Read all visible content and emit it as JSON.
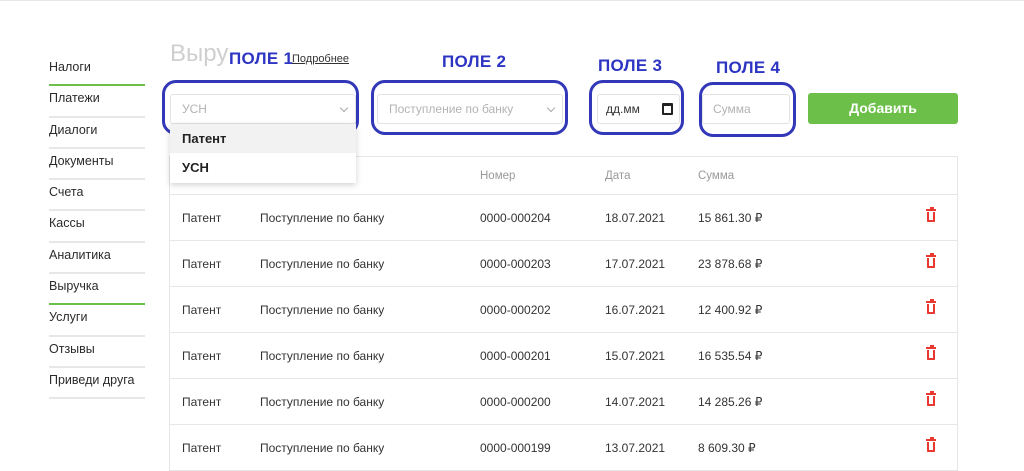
{
  "sidebar": {
    "items": [
      {
        "label": "Налоги",
        "active": true
      },
      {
        "label": "Платежи",
        "active": false
      },
      {
        "label": "Диалоги",
        "active": false
      },
      {
        "label": "Документы",
        "active": false
      },
      {
        "label": "Счета",
        "active": false
      },
      {
        "label": "Кассы",
        "active": false
      },
      {
        "label": "Аналитика",
        "active": false
      },
      {
        "label": "Выручка",
        "active": true
      },
      {
        "label": "Услуги",
        "active": false
      },
      {
        "label": "Отзывы",
        "active": false
      },
      {
        "label": "Приведи друга",
        "active": false
      }
    ]
  },
  "header": {
    "title": "Выру",
    "more_link": "Подробнее"
  },
  "annotations": {
    "field1": "ПОЛЕ 1",
    "field2": "ПОЛЕ 2",
    "field3": "ПОЛЕ 3",
    "field4": "ПОЛЕ 4",
    "outline_color": "#3238b8"
  },
  "form": {
    "tax_select_value": "УСН",
    "operation_select_placeholder": "Поступление по банку",
    "date_placeholder": "дд.мм",
    "sum_placeholder": "Сумма",
    "add_button": "Добавить",
    "accent_color": "#6cc04a"
  },
  "dropdown": {
    "options": [
      "Патент",
      "УСН"
    ]
  },
  "table": {
    "headers": {
      "number": "Номер",
      "date": "Дата",
      "sum": "Сумма"
    },
    "rows": [
      {
        "tax": "Патент",
        "operation": "Поступление по банку",
        "number": "0000-000204",
        "date": "18.07.2021",
        "sum": "15 861.30 ₽"
      },
      {
        "tax": "Патент",
        "operation": "Поступление по банку",
        "number": "0000-000203",
        "date": "17.07.2021",
        "sum": "23 878.68 ₽"
      },
      {
        "tax": "Патент",
        "operation": "Поступление по банку",
        "number": "0000-000202",
        "date": "16.07.2021",
        "sum": "12 400.92 ₽"
      },
      {
        "tax": "Патент",
        "operation": "Поступление по банку",
        "number": "0000-000201",
        "date": "15.07.2021",
        "sum": "16 535.54 ₽"
      },
      {
        "tax": "Патент",
        "operation": "Поступление по банку",
        "number": "0000-000200",
        "date": "14.07.2021",
        "sum": "14 285.26 ₽"
      },
      {
        "tax": "Патент",
        "operation": "Поступление по банку",
        "number": "0000-000199",
        "date": "13.07.2021",
        "sum": "8 609.30 ₽"
      }
    ],
    "delete_color": "#e8382f"
  }
}
